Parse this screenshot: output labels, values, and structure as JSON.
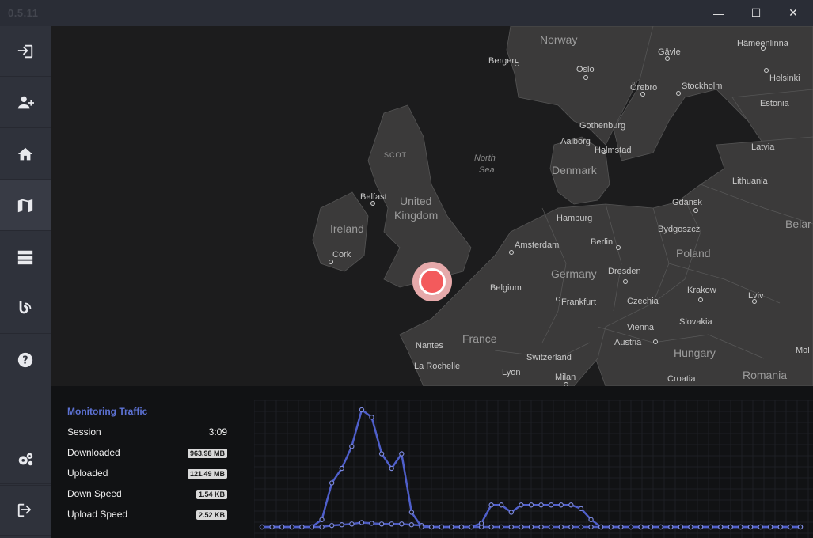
{
  "app": {
    "version": "0.5.11"
  },
  "window_controls": [
    {
      "name": "minimize-button",
      "glyph": "—"
    },
    {
      "name": "maximize-button",
      "glyph": "☐"
    },
    {
      "name": "close-button",
      "glyph": "✕"
    }
  ],
  "sidebar": {
    "items": [
      {
        "name": "login-icon"
      },
      {
        "name": "add-user-icon"
      },
      {
        "name": "home-icon"
      },
      {
        "name": "map-icon",
        "active": true
      },
      {
        "name": "server-list-icon"
      },
      {
        "name": "blog-icon"
      },
      {
        "name": "help-icon"
      },
      {
        "name": "settings-icon"
      },
      {
        "name": "logout-icon"
      }
    ]
  },
  "map": {
    "countries": [
      "Norway",
      "Denmark",
      "United",
      "Kingdom",
      "Ireland",
      "Germany",
      "Poland",
      "France",
      "Czechia",
      "Hungary",
      "Romania",
      "Slovakia",
      "Austria",
      "Switzerland",
      "Belgium",
      "Estonia",
      "Latvia",
      "Lithuania",
      "Croatia",
      "Belar",
      "Mol"
    ],
    "sea": [
      "North",
      "Sea"
    ],
    "region": "SCOT.",
    "cities": [
      "Bergen",
      "Oslo",
      "Gävle",
      "Hämeenlinna",
      "Helsinki",
      "Örebro",
      "Stockholm",
      "Gothenburg",
      "Aalborg",
      "Halmstad",
      "Belfast",
      "Cork",
      "Hamburg",
      "Gdansk",
      "Bydgoszcz",
      "Amsterdam",
      "Berlin",
      "Dresden",
      "Krakow",
      "Lviv",
      "Frankfurt",
      "Vienna",
      "Nantes",
      "La Rochelle",
      "Lyon",
      "Milan"
    ]
  },
  "traffic": {
    "title": "Monitoring Traffic",
    "session": {
      "label": "Session",
      "value": "3:09"
    },
    "downloaded": {
      "label": "Downloaded",
      "value": "963.98 MB"
    },
    "uploaded": {
      "label": "Uploaded",
      "value": "121.49 MB"
    },
    "down_speed": {
      "label": "Down Speed",
      "value": "1.54 KB"
    },
    "upload_speed": {
      "label": "Upload Speed",
      "value": "2.52 KB"
    }
  },
  "chart_data": {
    "type": "line",
    "series": [
      {
        "values": [
          0,
          0,
          0,
          0,
          0,
          0,
          1,
          6,
          8,
          11,
          16,
          15,
          10,
          8,
          10,
          2,
          0,
          0,
          0,
          0,
          0,
          0,
          0.5,
          3,
          3,
          2,
          3,
          3,
          3,
          3,
          3,
          3,
          2.5,
          1,
          0,
          0,
          0,
          0,
          0,
          0,
          0,
          0,
          0,
          0,
          0,
          0,
          0,
          0,
          0,
          0,
          0,
          0,
          0,
          0,
          0
        ]
      },
      {
        "values": [
          0,
          0,
          0,
          0,
          0,
          0,
          0,
          0.2,
          0.3,
          0.4,
          0.6,
          0.5,
          0.4,
          0.4,
          0.4,
          0.3,
          0.2,
          0,
          0,
          0,
          0,
          0,
          0,
          0,
          0,
          0,
          0,
          0,
          0,
          0,
          0,
          0,
          0,
          0,
          0,
          0,
          0,
          0,
          0,
          0,
          0,
          0,
          0,
          0,
          0,
          0,
          0,
          0,
          0,
          0,
          0,
          0,
          0,
          0,
          0
        ]
      }
    ],
    "colors": [
      "#4f5fcb",
      "#4b5ac0"
    ],
    "grid": true
  }
}
